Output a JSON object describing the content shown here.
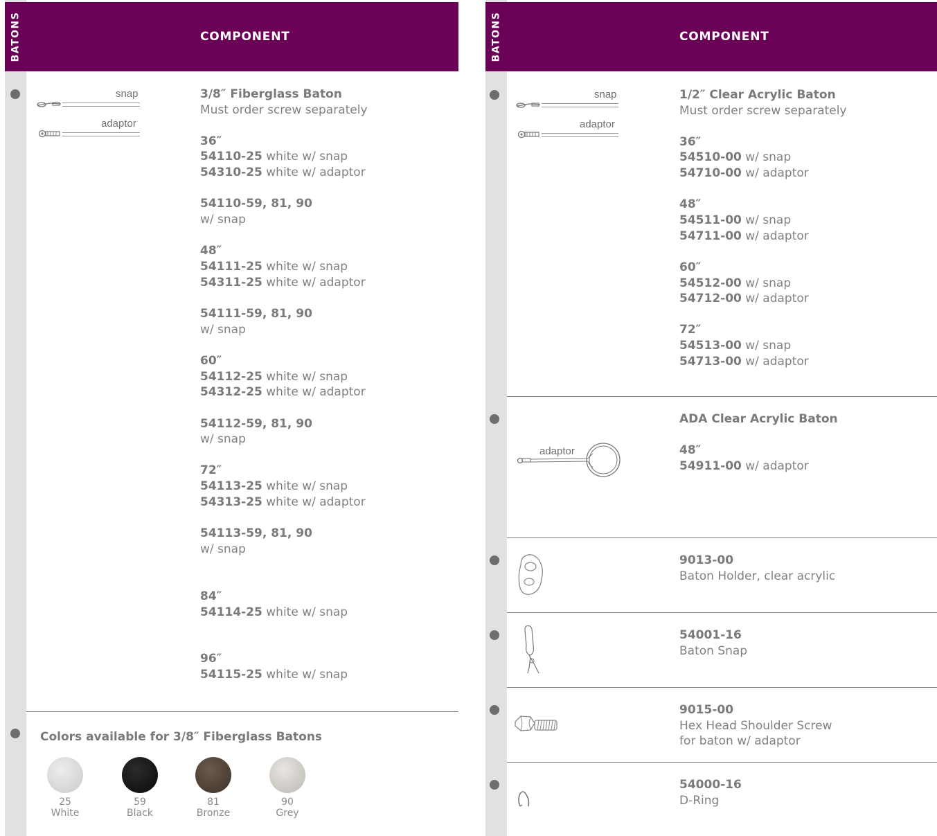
{
  "left": {
    "side_tab": "BATONS",
    "header": "COMPONENT",
    "illustration_labels": {
      "snap": "snap",
      "adaptor": "adaptor"
    },
    "product": {
      "title": "3/8″ Fiberglass Baton",
      "note": "Must order screw separately"
    },
    "groups": [
      {
        "size": "36″",
        "lines": [
          {
            "code": "54110-25",
            "desc": " white w/ snap"
          },
          {
            "code": "54310-25",
            "desc": " white w/ adaptor"
          }
        ],
        "extra": {
          "code": "54110-59, 81, 90",
          "desc": "w/ snap"
        }
      },
      {
        "size": "48″",
        "lines": [
          {
            "code": "54111-25",
            "desc": " white w/ snap"
          },
          {
            "code": "54311-25",
            "desc": " white w/ adaptor"
          }
        ],
        "extra": {
          "code": "54111-59, 81, 90",
          "desc": "w/ snap"
        }
      },
      {
        "size": "60″",
        "lines": [
          {
            "code": "54112-25",
            "desc": " white w/ snap"
          },
          {
            "code": "54312-25",
            "desc": " white w/ adaptor"
          }
        ],
        "extra": {
          "code": "54112-59, 81, 90",
          "desc": "w/ snap"
        }
      },
      {
        "size": "72″",
        "lines": [
          {
            "code": "54113-25",
            "desc": " white w/ snap"
          },
          {
            "code": "54313-25",
            "desc": " white w/ adaptor"
          }
        ],
        "extra": {
          "code": "54113-59, 81, 90",
          "desc": "w/ snap"
        }
      },
      {
        "size": "84″",
        "lines": [
          {
            "code": "54114-25",
            "desc": " white w/ snap"
          }
        ]
      },
      {
        "size": "96″",
        "lines": [
          {
            "code": "54115-25",
            "desc": " white w/ snap"
          }
        ]
      }
    ],
    "colors": {
      "title": "Colors available for 3/8″ Fiberglass Batons",
      "swatches": [
        {
          "code": "25",
          "name": "White",
          "color": "#d9dadc"
        },
        {
          "code": "59",
          "name": "Black",
          "color": "#141414"
        },
        {
          "code": "81",
          "name": "Bronze",
          "color": "#4c3c30"
        },
        {
          "code": "90",
          "name": "Grey",
          "color": "#cfcbc6"
        }
      ]
    }
  },
  "right": {
    "side_tab": "BATONS",
    "header": "COMPONENT",
    "illustration_labels": {
      "snap": "snap",
      "adaptor": "adaptor",
      "ada_adaptor": "adaptor"
    },
    "acrylic": {
      "title": "1/2″ Clear Acrylic Baton",
      "note": "Must order screw separately",
      "groups": [
        {
          "size": "36″",
          "lines": [
            {
              "code": "54510-00",
              "desc": " w/ snap"
            },
            {
              "code": "54710-00",
              "desc": " w/ adaptor"
            }
          ]
        },
        {
          "size": "48″",
          "lines": [
            {
              "code": "54511-00",
              "desc": " w/ snap"
            },
            {
              "code": "54711-00",
              "desc": " w/ adaptor"
            }
          ]
        },
        {
          "size": "60″",
          "lines": [
            {
              "code": "54512-00",
              "desc": " w/ snap"
            },
            {
              "code": "54712-00",
              "desc": " w/ adaptor"
            }
          ]
        },
        {
          "size": "72″",
          "lines": [
            {
              "code": "54513-00",
              "desc": " w/ snap"
            },
            {
              "code": "54713-00",
              "desc": " w/ adaptor"
            }
          ]
        }
      ]
    },
    "ada": {
      "title": "ADA Clear Acrylic Baton",
      "size": "48″",
      "code": "54911-00",
      "desc": " w/ adaptor"
    },
    "parts": [
      {
        "code": "9013-00",
        "desc": [
          "Baton Holder, clear acrylic"
        ],
        "icon": "baton-holder-icon"
      },
      {
        "code": "54001-16",
        "desc": [
          "Baton Snap"
        ],
        "icon": "baton-snap-icon"
      },
      {
        "code": "9015-00",
        "desc": [
          "Hex Head Shoulder Screw",
          "for baton w/ adaptor"
        ],
        "icon": "hex-screw-icon"
      },
      {
        "code": "54000-16",
        "desc": [
          "D-Ring"
        ],
        "icon": "d-ring-icon"
      }
    ]
  }
}
